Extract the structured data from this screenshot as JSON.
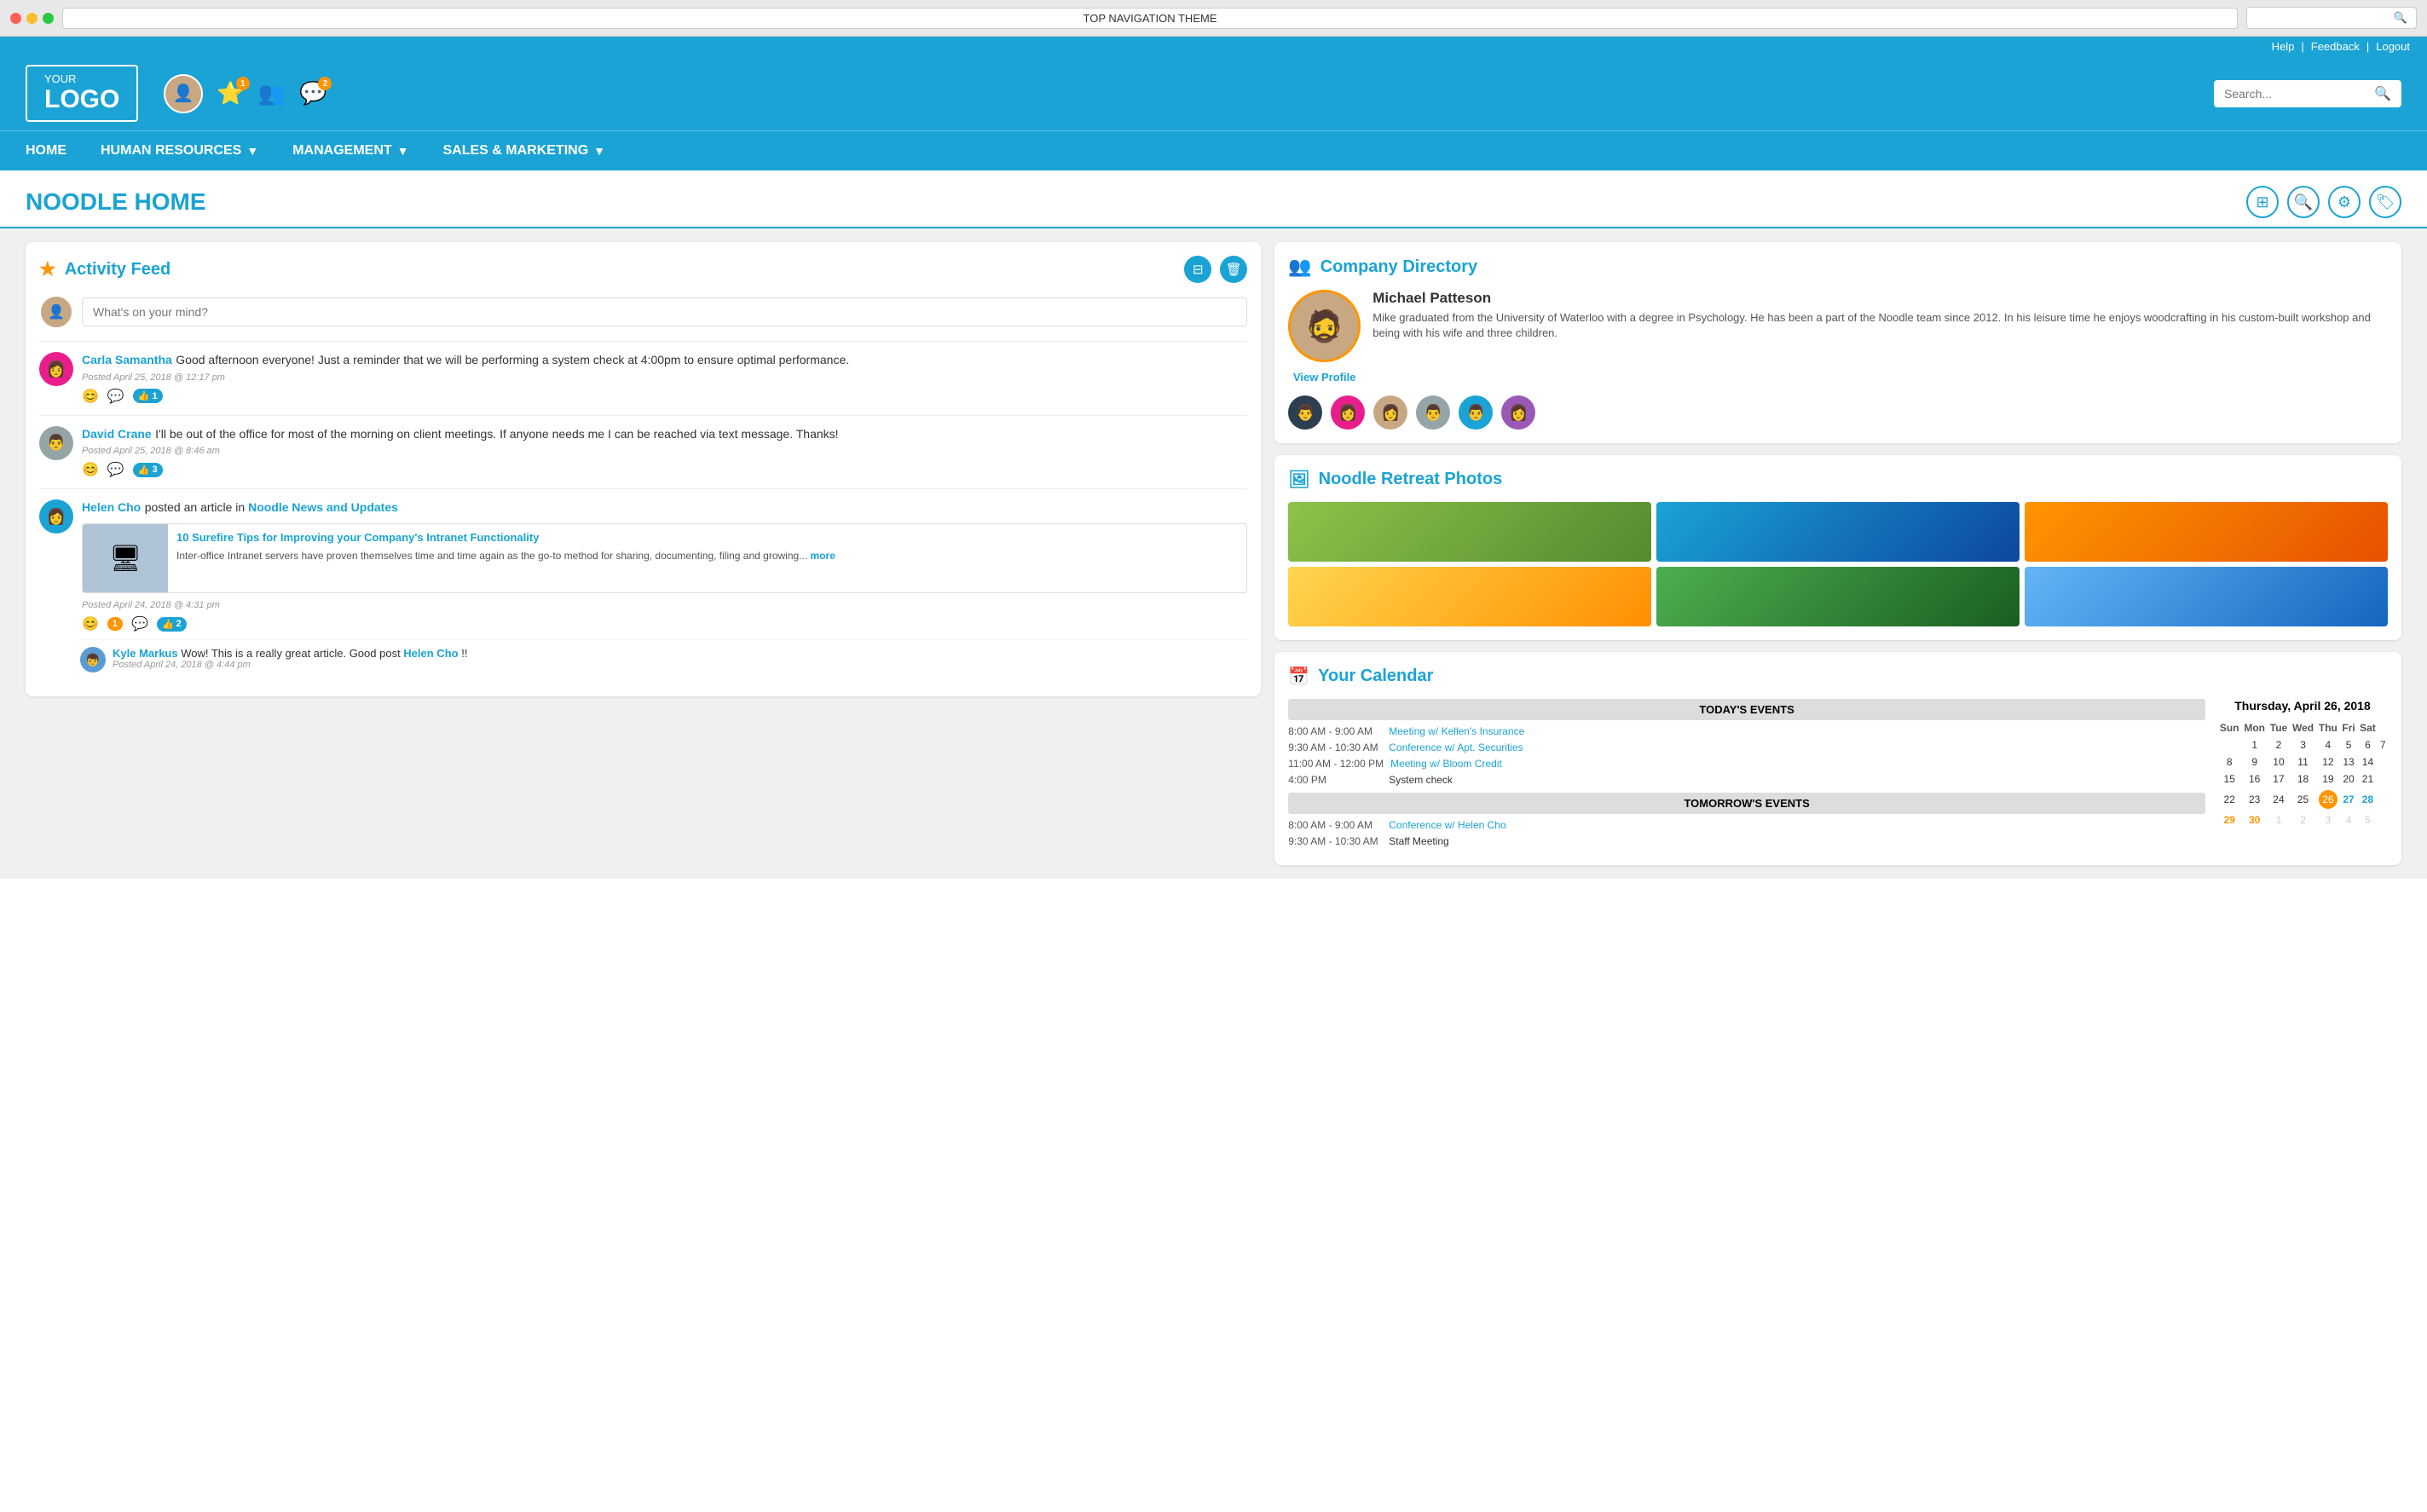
{
  "browser": {
    "url_text": "TOP NAVIGATION THEME",
    "search_placeholder": "🔍"
  },
  "utility_bar": {
    "help": "Help",
    "separator1": "|",
    "feedback": "Feedback",
    "separator2": "|",
    "logout": "Logout"
  },
  "header": {
    "logo_your": "YOUR",
    "logo_text": "LOGO",
    "search_placeholder": "Search...",
    "avatar_icon": "👤",
    "star_badge": "1",
    "people_icon": "👥",
    "chat_badge": "2"
  },
  "nav": {
    "items": [
      {
        "label": "HOME",
        "has_dropdown": false
      },
      {
        "label": "HUMAN RESOURCES",
        "has_dropdown": true
      },
      {
        "label": "MANAGEMENT",
        "has_dropdown": true
      },
      {
        "label": "SALES & MARKETING",
        "has_dropdown": true
      }
    ]
  },
  "page": {
    "title": "NOODLE HOME"
  },
  "activity_feed": {
    "title": "Activity Feed",
    "post_placeholder": "What's on your mind?",
    "posts": [
      {
        "author": "Carla Samantha",
        "text": "Good afternoon everyone! Just a reminder that we will be performing a system check at 4:00pm to ensure optimal performance.",
        "time": "Posted April 25, 2018 @ 12:17 pm",
        "likes": "1"
      },
      {
        "author": "David Crane",
        "text": "I'll be out of the office for most of the morning on client meetings. If anyone needs me I can be reached via text message. Thanks!",
        "time": "Posted April 25, 2018 @ 8:46 am",
        "likes": "3"
      }
    ],
    "article_post": {
      "author": "Helen Cho",
      "verb": " posted an article in ",
      "channel": "Noodle News and Updates",
      "article_title": "10 Surefire Tips for Improving your Company's Intranet Functionality",
      "article_text": "Inter-office Intranet servers have proven themselves time and time again as the go-to method for sharing, documenting, filing and growing...",
      "more_label": "more",
      "time": "Posted April 24, 2018 @ 4:31 pm",
      "likes": "2",
      "reactions": "1",
      "comment": {
        "author": "Kyle Markus",
        "text": " Wow! This is a really great article. Good post ",
        "mention": "Helen Cho",
        "suffix": "!!",
        "time": "Posted April 24, 2018 @ 4:44 pm"
      }
    }
  },
  "company_directory": {
    "title": "Company Directory",
    "profile": {
      "name": "Michael Patteson",
      "bio": "Mike graduated from the University of Waterloo with a degree in Psychology. He has been a part of the Noodle team since 2012. In his leisure time he enjoys woodcrafting in his custom-built workshop and being with his wife and three children.",
      "view_profile": "View Profile"
    },
    "avatars": [
      {
        "color": "bg-darkblue"
      },
      {
        "color": "bg-pink"
      },
      {
        "color": "bg-brown"
      },
      {
        "color": "bg-gray"
      },
      {
        "color": "bg-teal"
      },
      {
        "color": "bg-purple"
      }
    ]
  },
  "photos": {
    "title": "Noodle Retreat Photos",
    "images": [
      "photo-1",
      "photo-2",
      "photo-3",
      "photo-4",
      "photo-5",
      "photo-6"
    ]
  },
  "calendar": {
    "title": "Your Calendar",
    "cal_date": "Thursday, April 26, 2018",
    "today_label": "TODAY'S EVENTS",
    "tomorrow_label": "TOMORROW'S EVENTS",
    "today_events": [
      {
        "time": "8:00 AM - 9:00 AM",
        "label": "Meeting w/ Kellen's Insurance",
        "is_link": true
      },
      {
        "time": "9:30 AM - 10:30 AM",
        "label": "Conference w/ Apt. Securities",
        "is_link": true
      },
      {
        "time": "11:00 AM - 12:00 PM",
        "label": "Meeting w/ Bloom Credit",
        "is_link": true
      },
      {
        "time": "4:00 PM",
        "label": "System check",
        "is_link": false
      }
    ],
    "tomorrow_events": [
      {
        "time": "8:00 AM - 9:00 AM",
        "label": "Conference w/ Helen Cho",
        "is_link": true
      },
      {
        "time": "9:30 AM - 10:30 AM",
        "label": "Staff Meeting",
        "is_link": false
      }
    ],
    "cal_headers": [
      "Sun",
      "Mon",
      "Tue",
      "Wed",
      "Thu",
      "Fri",
      "Sat"
    ],
    "cal_weeks": [
      [
        "",
        "1",
        "2",
        "3",
        "4",
        "5",
        "6",
        "7"
      ],
      [
        "",
        "8",
        "9",
        "10",
        "11",
        "12",
        "13",
        "14"
      ],
      [
        "",
        "15",
        "16",
        "17",
        "18",
        "19",
        "20",
        "21"
      ],
      [
        "",
        "22",
        "23",
        "24",
        "25",
        "26",
        "27",
        "28"
      ],
      [
        "",
        "29",
        "30",
        "1",
        "2",
        "3",
        "4",
        "5"
      ]
    ],
    "today_num": "26",
    "link_nums": [
      "27",
      "28"
    ],
    "orange_nums": [
      "30"
    ],
    "prev_month_nums": [
      "1",
      "2",
      "3",
      "4",
      "5"
    ]
  }
}
